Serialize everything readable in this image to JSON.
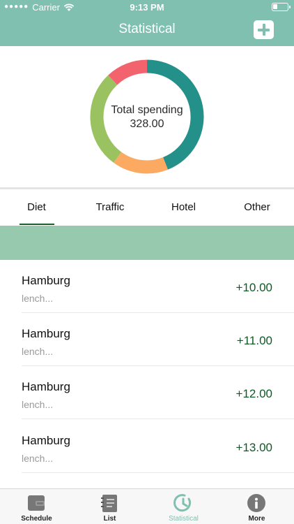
{
  "status_bar": {
    "carrier": "Carrier",
    "time": "9:13 PM"
  },
  "header": {
    "title": "Statistical",
    "add_icon": "plus-icon"
  },
  "chart_data": {
    "type": "pie",
    "center_label": "Total spending",
    "center_value": "328.00",
    "slices": [
      {
        "color": "#239089",
        "fraction": 0.44
      },
      {
        "color": "#fcaa62",
        "fraction": 0.16
      },
      {
        "color": "#9bc260",
        "fraction": 0.28
      },
      {
        "color": "#f3636d",
        "fraction": 0.12
      }
    ]
  },
  "tabs": [
    {
      "label": "Diet",
      "active": true
    },
    {
      "label": "Traffic",
      "active": false
    },
    {
      "label": "Hotel",
      "active": false
    },
    {
      "label": "Other",
      "active": false
    }
  ],
  "rows": [
    {
      "title": "Hamburg",
      "subtitle": "lench...",
      "amount": "+10.00"
    },
    {
      "title": "Hamburg",
      "subtitle": "lench...",
      "amount": "+11.00"
    },
    {
      "title": "Hamburg",
      "subtitle": "lench...",
      "amount": "+12.00"
    },
    {
      "title": "Hamburg",
      "subtitle": "lench...",
      "amount": "+13.00"
    }
  ],
  "tabbar": [
    {
      "label": "Schedule",
      "icon": "wallet-icon",
      "active": false
    },
    {
      "label": "List",
      "icon": "notebook-icon",
      "active": false
    },
    {
      "label": "Statistical",
      "icon": "clock-icon",
      "active": true
    },
    {
      "label": "More",
      "icon": "info-icon",
      "active": false
    }
  ],
  "colors": {
    "accent": "#7fc0b0",
    "band": "#97c9ae",
    "amount": "#0d5a24"
  }
}
